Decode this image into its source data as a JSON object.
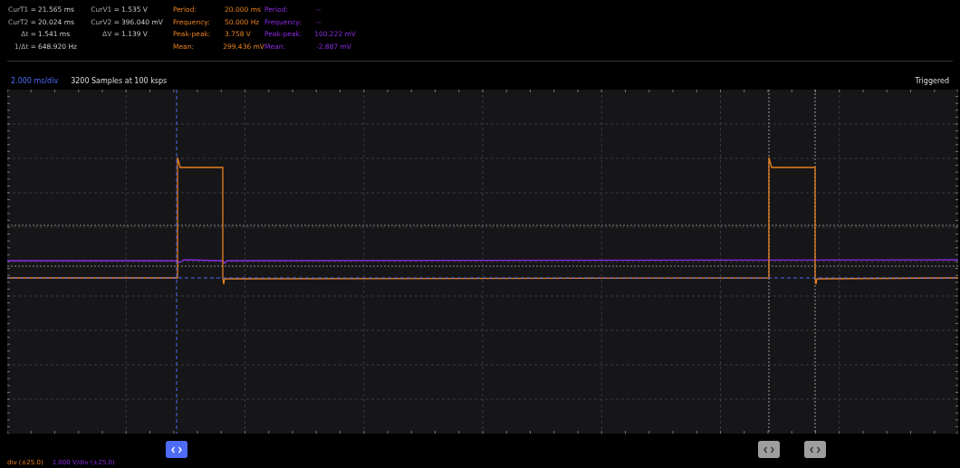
{
  "cursor_readout": {
    "time": [
      {
        "label": "CurT1 =",
        "value": "21.565 ms"
      },
      {
        "label": "CurT2 =",
        "value": "20.024 ms"
      },
      {
        "label": "Δt =",
        "value": "1.541 ms"
      },
      {
        "label": "1/Δt =",
        "value": "648.920 Hz"
      }
    ],
    "voltage": [
      {
        "label": "CurV1 =",
        "value": "1.535 V"
      },
      {
        "label": "CurV2 =",
        "value": "396.040 mV"
      },
      {
        "label": "ΔV =",
        "value": "1.139 V"
      }
    ]
  },
  "channel_stats": [
    {
      "color": "#e8801e",
      "rows": [
        {
          "label": "Period:",
          "value": "20.000 ms"
        },
        {
          "label": "Frequency:",
          "value": "50.000 Hz"
        },
        {
          "label": "Peak-peak:",
          "value": "3.758 V"
        },
        {
          "label": "Mean:",
          "value": "299.436 mV"
        }
      ]
    },
    {
      "color": "#8a2be2",
      "rows": [
        {
          "label": "Period:",
          "value": "--"
        },
        {
          "label": "Frequency:",
          "value": "--"
        },
        {
          "label": "Peak-peak:",
          "value": "100.222 mV"
        },
        {
          "label": "Mean:",
          "value": "-2.887 mV"
        }
      ]
    }
  ],
  "timebase": "2.000 ms/div",
  "samples": "3200 Samples at 100 ksps",
  "trigger_status": "Triggered",
  "cursor_handles": [
    {
      "selected": true
    },
    {
      "selected": false
    },
    {
      "selected": false
    }
  ],
  "channel_scales": [
    {
      "text": "div (±25.0)"
    },
    {
      "text": "1.000 V/div (±25.0)"
    }
  ]
}
